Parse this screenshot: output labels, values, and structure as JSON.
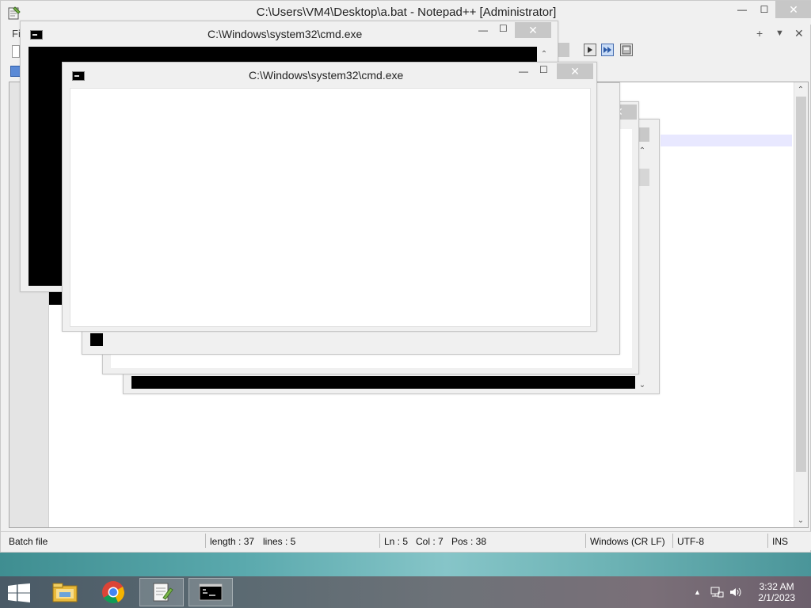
{
  "notepad": {
    "title": "C:\\Users\\VM4\\Desktop\\a.bat - Notepad++ [Administrator]",
    "menu_first": "Fil",
    "minimize": "—",
    "maximize": "☐",
    "close": "✕",
    "tab_add": "+",
    "tab_menu": "▼",
    "tab_close": "✕"
  },
  "statusbar": {
    "file_type": "Batch file",
    "length": "length : 37",
    "lines": "lines : 5",
    "ln": "Ln : 5",
    "col": "Col : 7",
    "pos": "Pos : 38",
    "eol": "Windows (CR LF)",
    "encoding": "UTF-8",
    "mode": "INS"
  },
  "cmd_windows": [
    {
      "title": "C:\\Windows\\system32\\cmd.exe"
    },
    {
      "title": "C:\\Windows\\system32\\cmd.exe"
    }
  ],
  "cmd_controls": {
    "minimize": "—",
    "maximize": "☐",
    "close": "✕"
  },
  "scroll": {
    "up": "⌃",
    "down": "⌄"
  },
  "taskbar": {
    "items": [
      "file-explorer",
      "chrome",
      "notepad-plus-plus",
      "command-prompt"
    ],
    "tray_chevron": "▲",
    "clock_time": "3:32 AM",
    "clock_date": "2/1/2023"
  },
  "colors": {
    "close_button": "#c7c7c7",
    "taskbar_start": "#4a5a66",
    "cmd_black": "#000000"
  }
}
